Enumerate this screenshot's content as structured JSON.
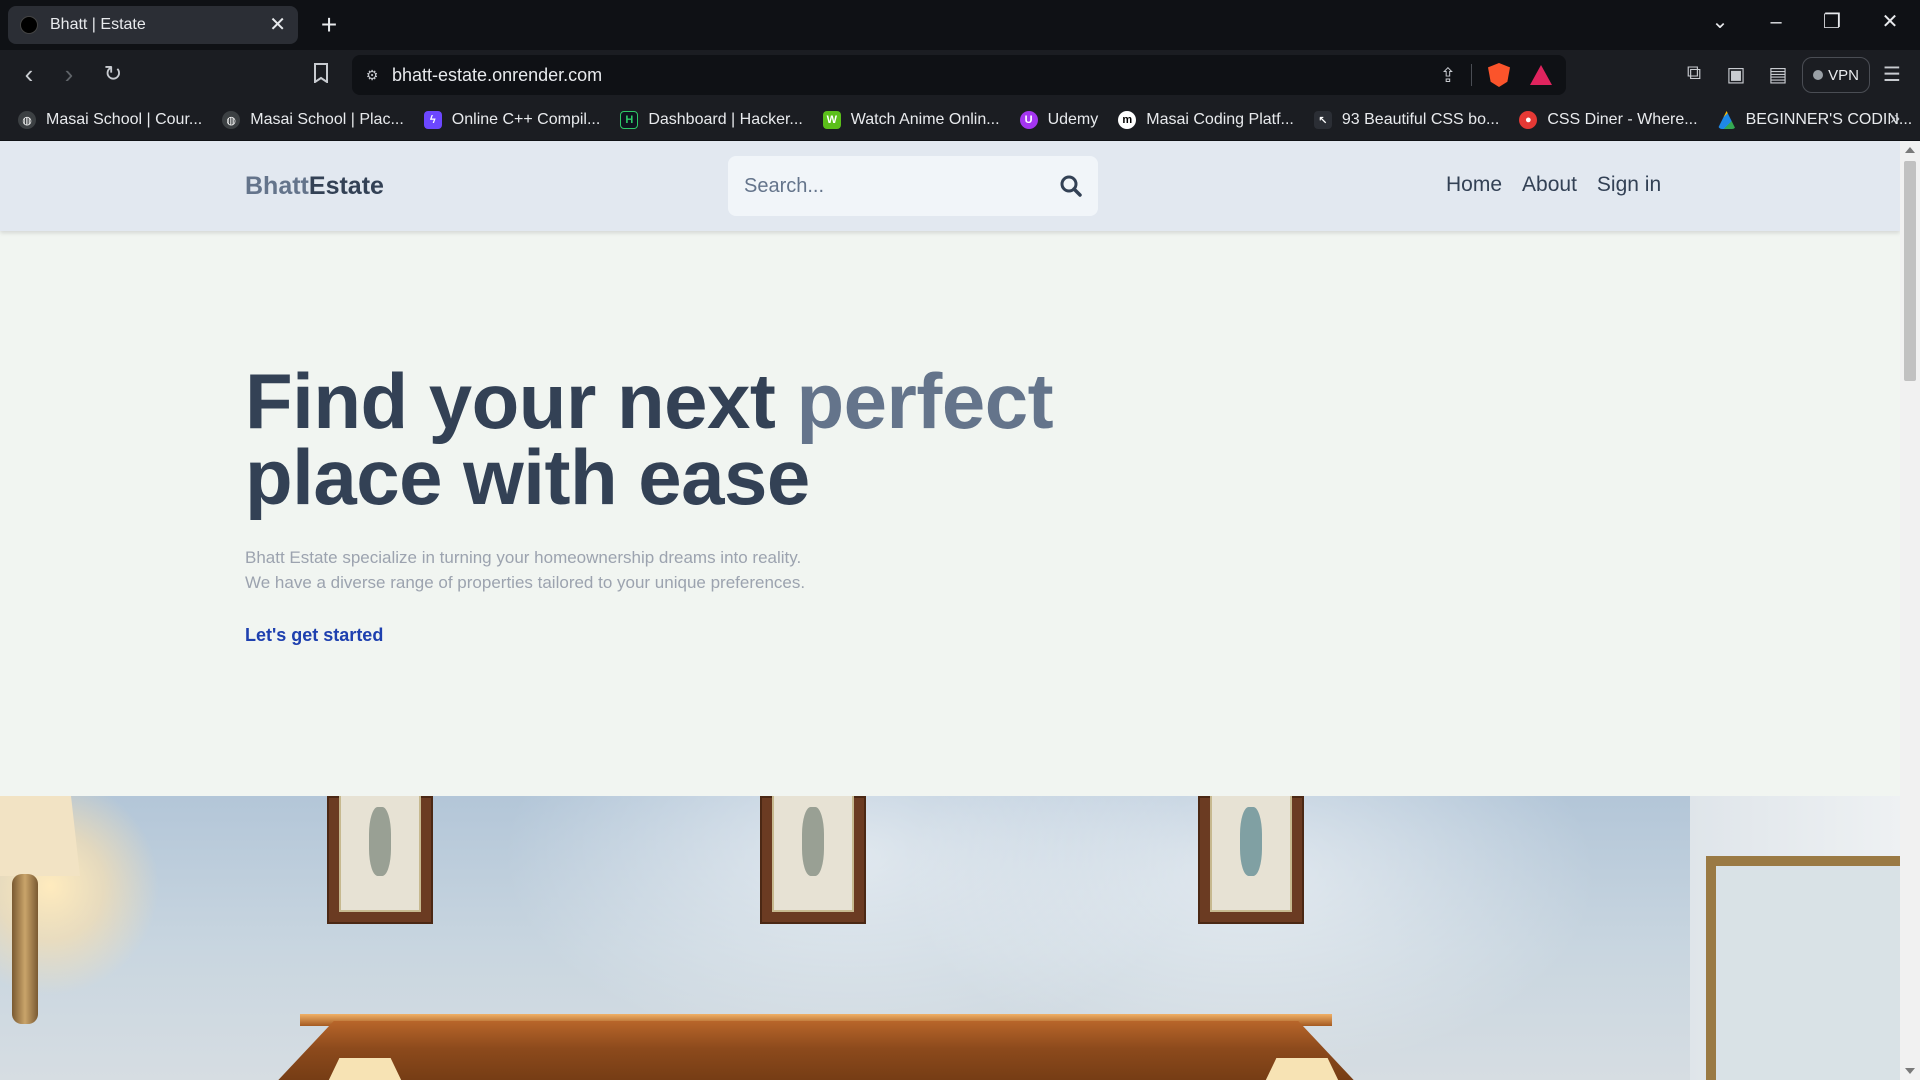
{
  "browser": {
    "tab": {
      "title": "Bhatt | Estate"
    },
    "url": "bhatt-estate.onrender.com",
    "vpn_label": "VPN",
    "bookmarks": [
      {
        "label": "Masai School | Cour...",
        "icon": "globe-icon",
        "color": "#3c4043"
      },
      {
        "label": "Masai School | Plac...",
        "icon": "globe-icon",
        "color": "#3c4043"
      },
      {
        "label": "Online C++ Compil...",
        "icon": "bolt-icon",
        "color": "#6c47ff"
      },
      {
        "label": "Dashboard | Hacker...",
        "icon": "hackerrank-icon",
        "color": "#0e141e"
      },
      {
        "label": "Watch Anime Onlin...",
        "icon": "anime-icon",
        "color": "#5bbf1a"
      },
      {
        "label": "Udemy",
        "icon": "udemy-icon",
        "color": "#a435f0"
      },
      {
        "label": "Masai Coding Platf...",
        "icon": "masai-icon",
        "color": "#ffffff"
      },
      {
        "label": "93 Beautiful CSS bo...",
        "icon": "css-icon",
        "color": "#2b2e35"
      },
      {
        "label": "CSS Diner - Where...",
        "icon": "css-diner-icon",
        "color": "#e53935"
      },
      {
        "label": "BEGINNER'S CODIN...",
        "icon": "drive-icon",
        "color": "#1e88e5"
      }
    ],
    "more_bookmarks": "»"
  },
  "site": {
    "logo": {
      "part1": "Bhatt",
      "part2": "Estate"
    },
    "search": {
      "placeholder": "Search..."
    },
    "nav": [
      "Home",
      "About",
      "Sign in"
    ],
    "hero": {
      "title_start": "Find your next ",
      "title_accent": "perfect",
      "title_end": "place with ease",
      "desc_line1": "Bhatt Estate specialize in turning your homeownership dreams into reality.",
      "desc_line2": "We have a diverse range of properties tailored to your unique preferences.",
      "cta": "Let's get started"
    }
  },
  "colors": {
    "header_bg": "#e2e8f0",
    "page_bg": "#f1f5f1",
    "text_dark": "#334155",
    "text_muted": "#64748b",
    "cta": "#1e40af"
  }
}
